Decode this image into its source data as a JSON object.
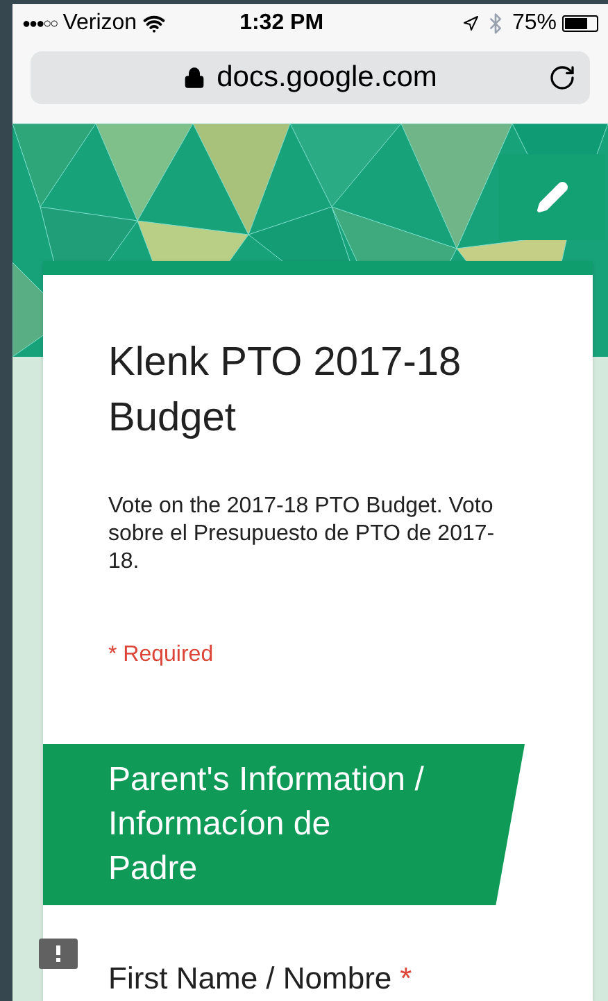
{
  "status_bar": {
    "signal_dots": "●●●○○",
    "carrier": "Verizon",
    "time": "1:32 PM",
    "battery": "75%"
  },
  "address_bar": {
    "url": "docs.google.com"
  },
  "form": {
    "title": "Klenk PTO 2017-18 Budget",
    "description": "Vote on the 2017-18 PTO Budget. Voto sobre el Presupuesto de PTO de 2017-18.",
    "required_note": "* Required",
    "section": {
      "title": "Parent's Information / Informacíon de Padre"
    },
    "questions": [
      {
        "label": "First Name / Nombre",
        "required_mark": "*"
      }
    ]
  }
}
